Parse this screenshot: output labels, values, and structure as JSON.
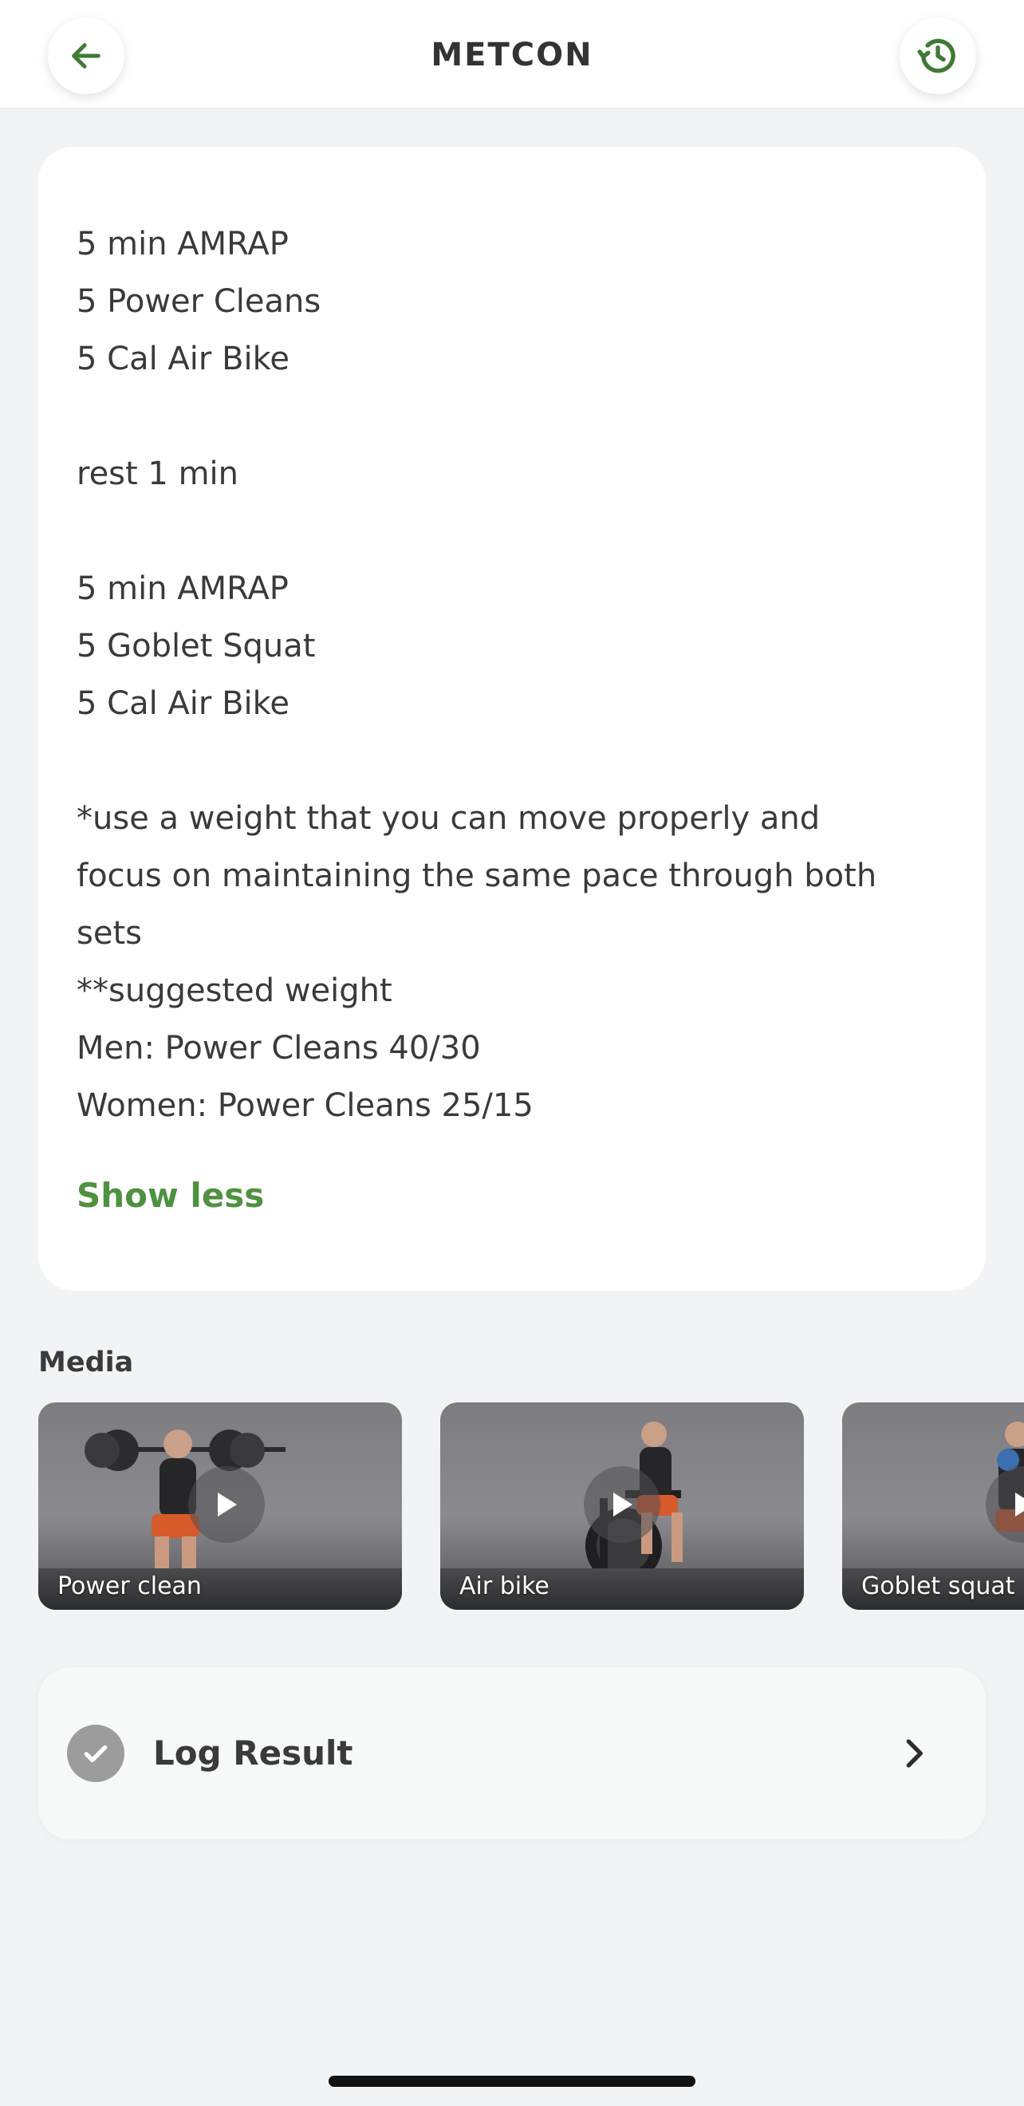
{
  "header": {
    "title": "METCON",
    "back_icon": "arrow-left-icon",
    "history_icon": "history-icon",
    "accent_color": "#3f7a33"
  },
  "workout": {
    "lines": [
      "5 min AMRAP",
      "5 Power Cleans",
      "5 Cal Air Bike",
      "",
      "rest 1 min",
      "",
      "5 min AMRAP",
      "5 Goblet Squat",
      "5 Cal Air Bike",
      "",
      "*use a weight that you can move properly and",
      "focus on maintaining the same pace through both",
      "sets",
      "**suggested weight",
      "Men: Power Cleans 40/30",
      "Women: Power Cleans 25/15"
    ],
    "toggle_label": "Show less"
  },
  "media": {
    "heading": "Media",
    "items": [
      {
        "label": "Power clean",
        "icon": "play-icon"
      },
      {
        "label": "Air bike",
        "icon": "play-icon"
      },
      {
        "label": "Goblet squat",
        "icon": "play-icon"
      }
    ]
  },
  "log_result": {
    "label": "Log Result",
    "status_icon": "check-icon",
    "chevron_icon": "chevron-right-icon"
  }
}
